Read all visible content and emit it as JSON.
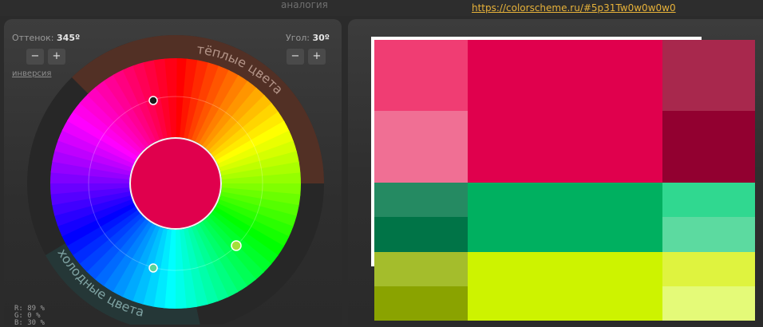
{
  "header": {
    "scheme_type": "аналогия",
    "scheme_url": "https://colorscheme.ru/#5p31Tw0w0w0w0"
  },
  "controls": {
    "hue_label": "Оттенок:",
    "hue_value": "345º",
    "angle_label": "Угол:",
    "angle_value": "30º",
    "minus": "−",
    "plus": "+",
    "inversion_link": "инверсия"
  },
  "wheel": {
    "warm_label": "тёплые цвета",
    "cold_label": "холодные цвета",
    "center_color": "#e0004d",
    "rgb_readout": {
      "r": "R: 89 %",
      "g": "G:   0 %",
      "b": "B: 30 %"
    }
  },
  "palette": {
    "rows": [
      {
        "left": "#f03d73",
        "main": "#e0004d",
        "right": "#a8284d"
      },
      {
        "left": "#f06f94",
        "main": "#e0004d",
        "right": "#920030"
      },
      {
        "left": "#258a62",
        "main": "#00b060",
        "right": "#30d890"
      },
      {
        "left": "#007447",
        "main": "#00b060",
        "right": "#5cdaa0"
      },
      {
        "left": "#a4bd2c",
        "main": "#cdf300",
        "right": "#dff33f"
      },
      {
        "left": "#8aa300",
        "main": "#cdf300",
        "right": "#e4fa78"
      }
    ]
  }
}
